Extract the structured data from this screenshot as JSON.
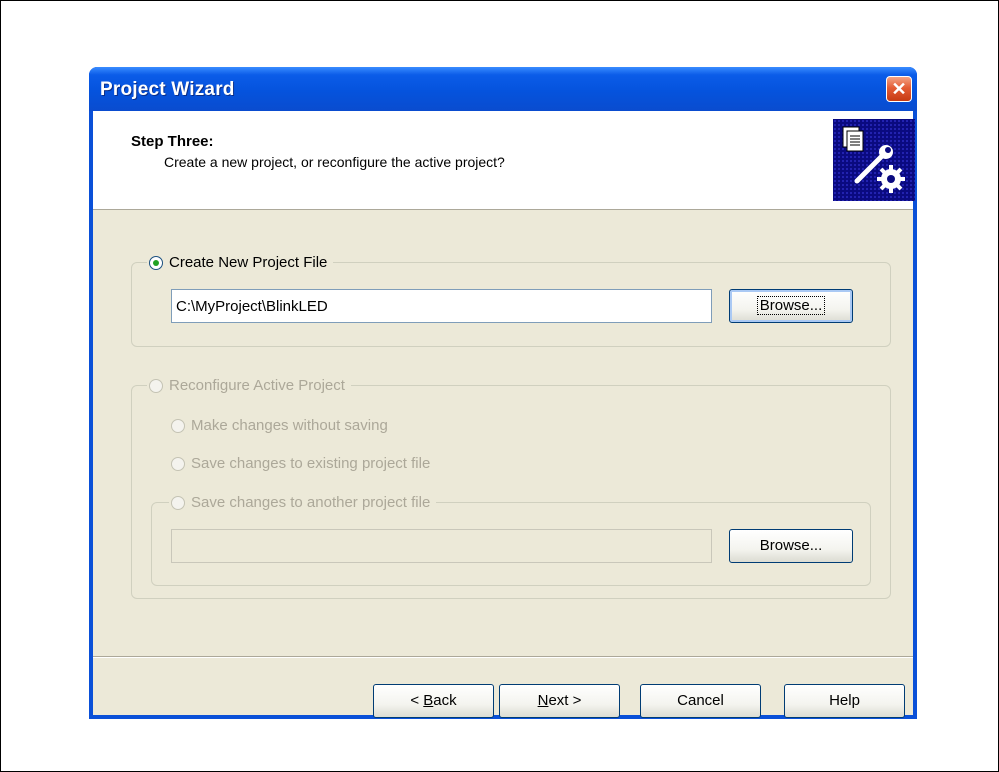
{
  "window": {
    "title": "Project Wizard",
    "close_icon": "close-icon"
  },
  "header": {
    "step_title": "Step Three:",
    "step_description": "Create a new project, or reconfigure the active project?",
    "icon": "project-settings-icon"
  },
  "create_new": {
    "label": "Create New Project File",
    "selected": true,
    "path_value": "C:\\MyProject\\BlinkLED",
    "browse_label": "Browse..."
  },
  "reconfigure": {
    "label": "Reconfigure Active Project",
    "enabled": false,
    "options": [
      {
        "label": "Make changes without saving"
      },
      {
        "label": "Save changes to existing project file"
      }
    ],
    "save_another": {
      "label": "Save changes to another project file",
      "path_value": "",
      "browse_label": "Browse..."
    }
  },
  "footer": {
    "back_prefix": "< ",
    "back_access": "B",
    "back_rest": "ack",
    "next_access": "N",
    "next_rest": "ext >",
    "cancel_label": "Cancel",
    "help_label": "Help"
  },
  "colors": {
    "titlebar": "#0553dd",
    "dialog_bg": "#ece9d8",
    "radio_check": "#21a121",
    "disabled_text": "#aca899"
  }
}
